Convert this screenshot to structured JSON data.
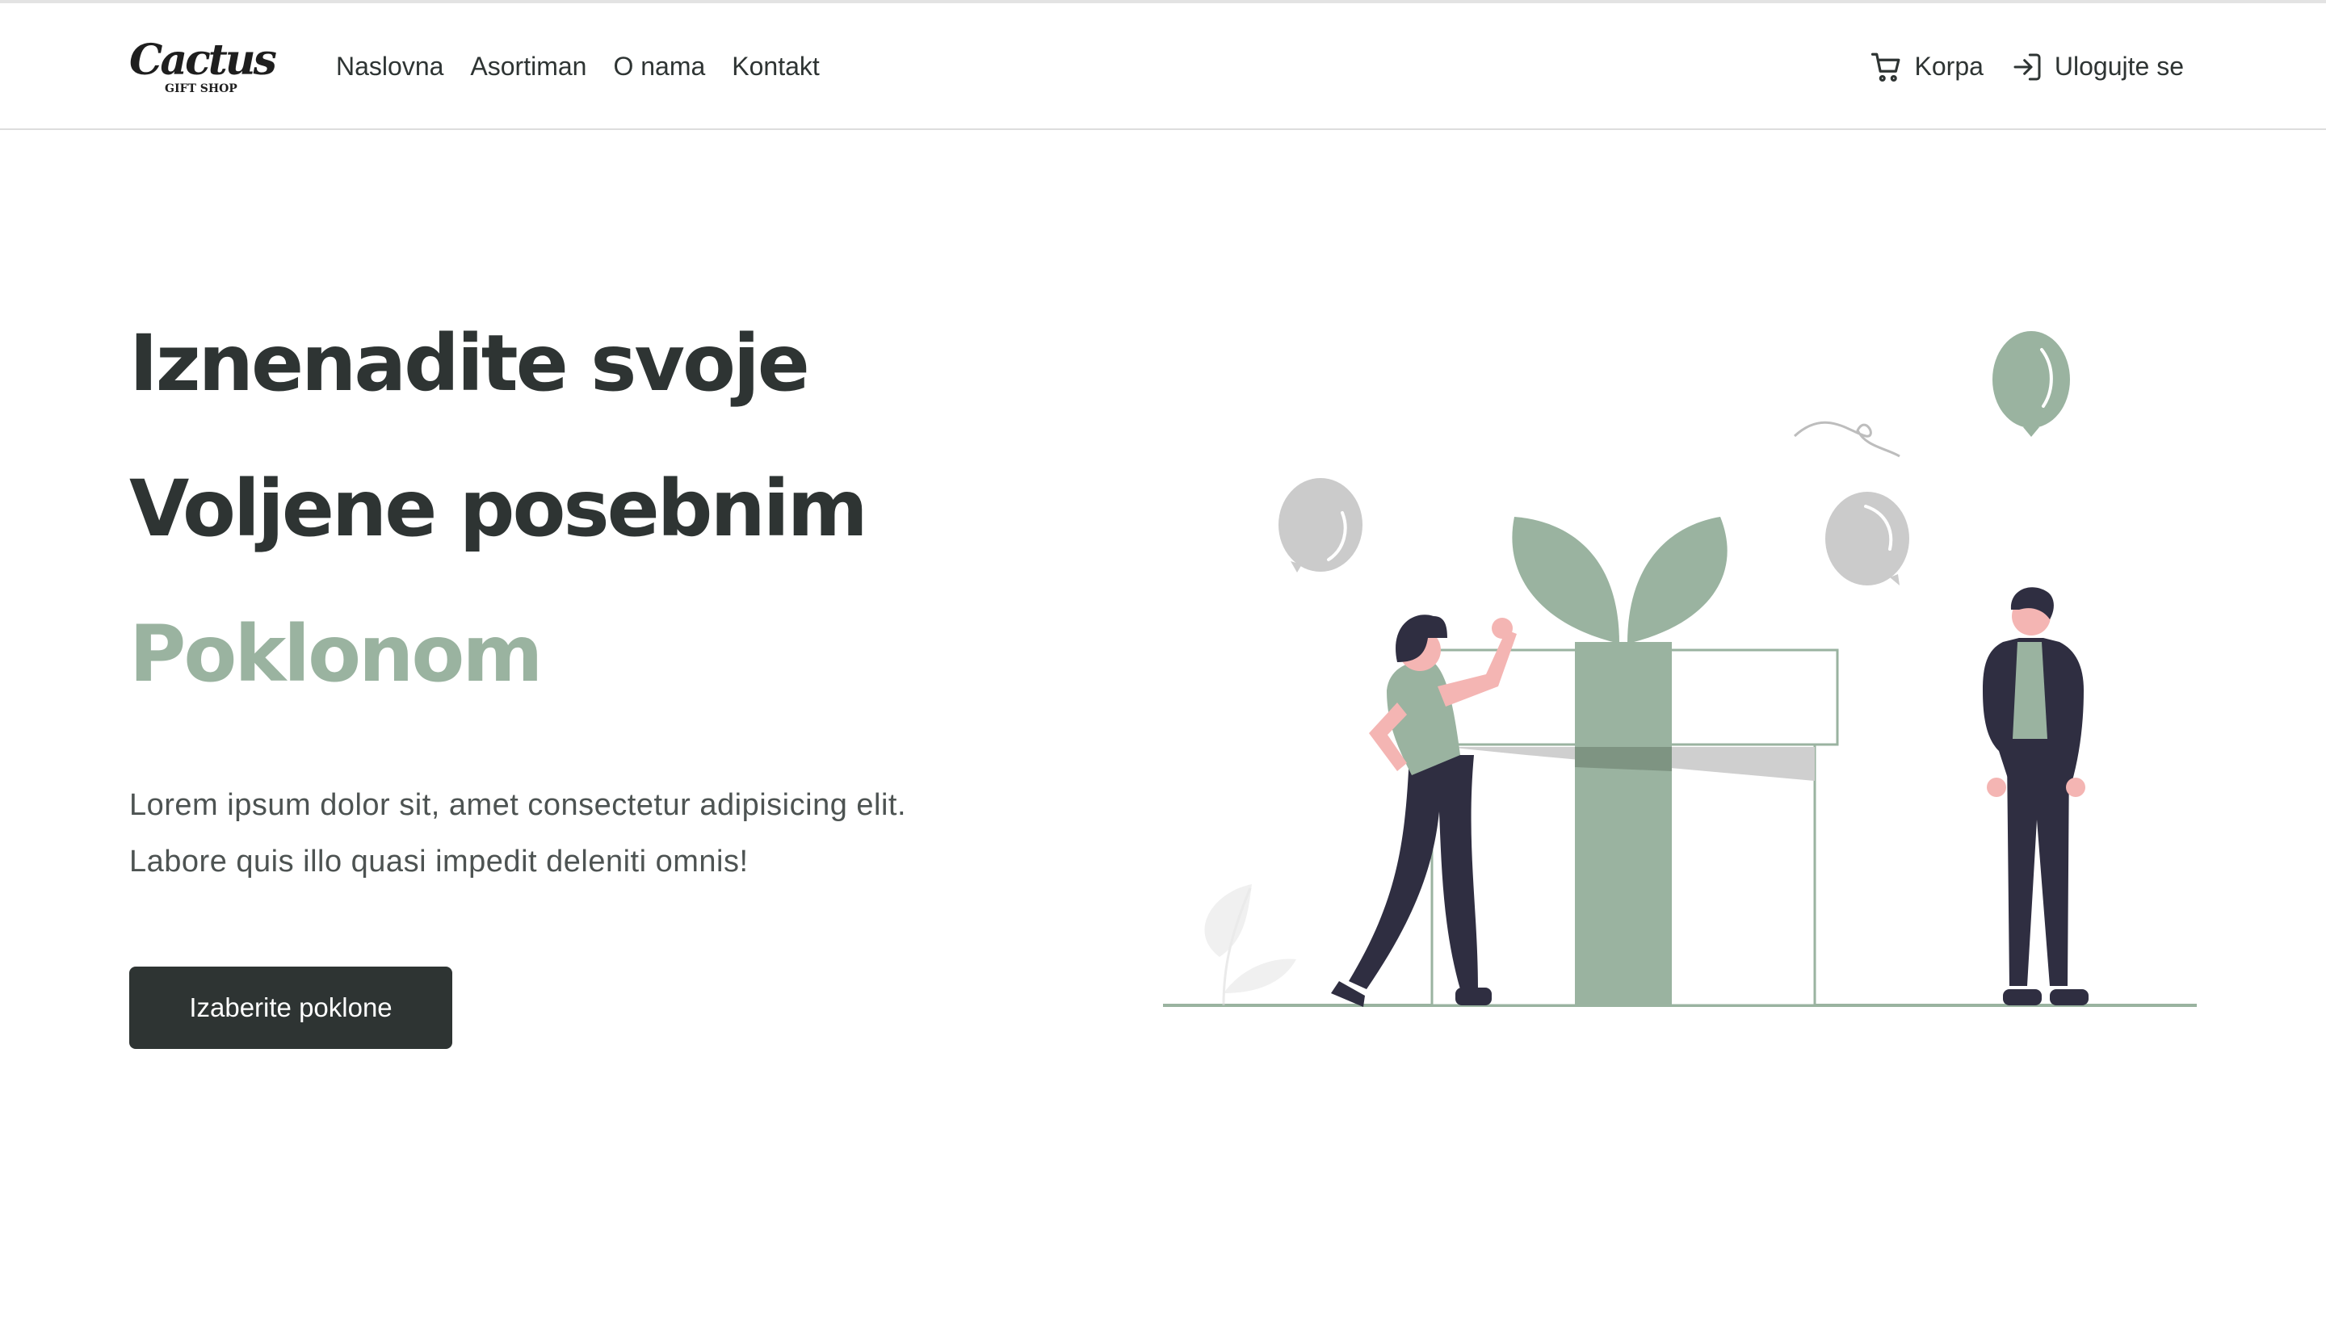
{
  "brand": {
    "logo_main": "Cactus",
    "logo_sub": "GIFT SHOP"
  },
  "nav": {
    "links": [
      "Naslovna",
      "Asortiman",
      "O nama",
      "Kontakt"
    ],
    "cart_label": "Korpa",
    "login_label": "Ulogujte se"
  },
  "hero": {
    "line1": "Iznenadite svoje",
    "line2": "Voljene posebnim",
    "line3": "Poklonom",
    "desc_line1": "Lorem ipsum dolor sit, amet consectetur adipisicing elit.",
    "desc_line2": "Labore quis illo quasi impedit deleniti omnis!",
    "cta_label": "Izaberite poklone"
  },
  "colors": {
    "accent_green": "#9ab3a0",
    "dark": "#2e3433",
    "figure_dark": "#2f2e41",
    "skin": "#f4b5b3",
    "balloon_gray": "#cbcbcb"
  },
  "icons": {
    "cart": "cart-icon",
    "login": "login-icon"
  }
}
